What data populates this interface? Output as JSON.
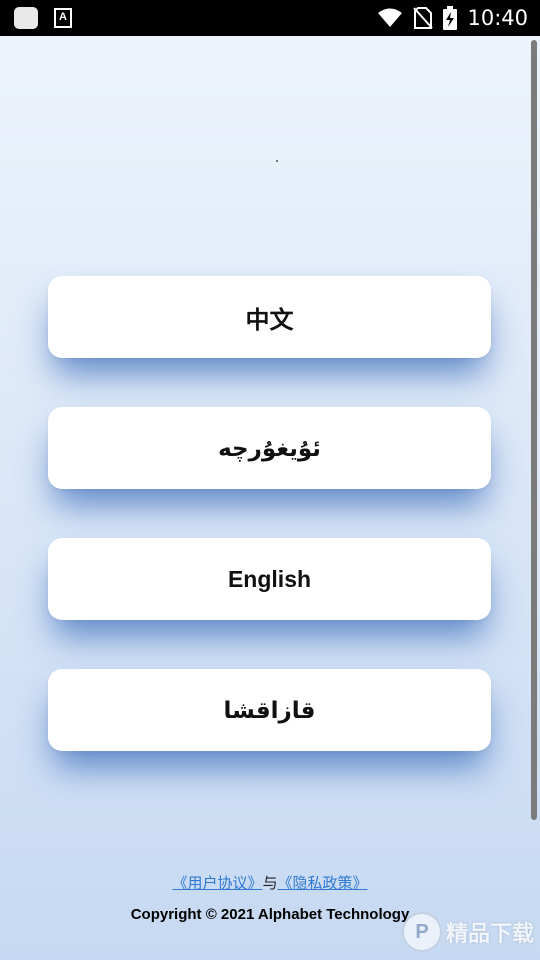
{
  "status_bar": {
    "time": "10:40",
    "font_icon_letter": "A"
  },
  "languages": [
    {
      "label": "中文"
    },
    {
      "label": "ئۇيغۇرچە"
    },
    {
      "label": "English"
    },
    {
      "label": "قازاقشا"
    }
  ],
  "footer": {
    "user_agreement": "《用户协议》",
    "connector": "与",
    "privacy_policy": "《隐私政策》",
    "copyright": "Copyright © 2021 Alphabet Technology"
  },
  "watermark": {
    "logo_letter": "P",
    "text": "精品下载"
  },
  "colors": {
    "accent_link": "#2f79d0",
    "button_shadow": "#3769b9"
  }
}
